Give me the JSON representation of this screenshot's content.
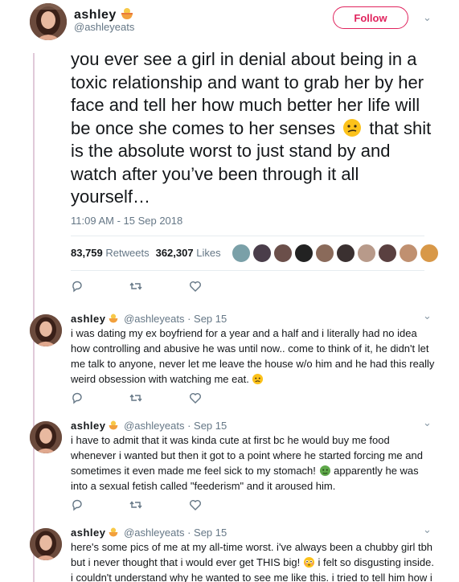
{
  "main_tweet": {
    "display_name": "ashley",
    "name_emoji": "bowl-emoji",
    "handle": "@ashleyeats",
    "follow_label": "Follow",
    "text_before_emoji": "you ever see a girl in denial about being in a toxic relationship and want to grab her by her face and tell her how much better her life will be once she comes to her senses",
    "text_emoji": "confused-face-emoji",
    "text_after_emoji": "that shit is the absolute worst to just stand by and watch after you’ve been through it all yourself…",
    "timestamp": "11:09 AM - 15 Sep 2018",
    "retweets_count": "83,759",
    "retweets_label": "Retweets",
    "likes_count": "362,307",
    "likes_label": "Likes",
    "liker_avatar_count": 10
  },
  "replies": [
    {
      "display_name": "ashley",
      "handle": "@ashleyeats",
      "date": "Sep 15",
      "text": "i was dating my ex boyfriend for a year and a half and i literally had no idea how controlling and abusive he was until now.. come to think of it, he didn't let me talk to anyone, never let me leave the house w/o him and he had this really weird obsession with watching me eat.",
      "text_emoji": "worried-face-emoji"
    },
    {
      "display_name": "ashley",
      "handle": "@ashleyeats",
      "date": "Sep 15",
      "text_before_emoji": "i have to admit that it was kinda cute at first bc he would buy me food whenever i wanted but then it got to a point where he started forcing me and sometimes it even made me feel sick to my stomach!",
      "text_emoji": "nauseated-face-emoji",
      "text_after_emoji": "apparently he was into a sexual fetish called \"feederism\" and it aroused him."
    },
    {
      "display_name": "ashley",
      "handle": "@ashleyeats",
      "date": "Sep 15",
      "text_before_emoji": "here's some pics of me at my all-time worst. i've always been a chubby girl tbh but i never thought that i would ever get THIS big!",
      "text_emoji": "flushed-face-emoji",
      "text_after_emoji": "i felt so disgusting inside. i couldn't understand why he wanted to see me like this. i tried to tell him how i"
    }
  ],
  "colors": {
    "follow_accent": "#e0245e",
    "thread_line": "#e0c9d9",
    "secondary_text": "#657786"
  }
}
